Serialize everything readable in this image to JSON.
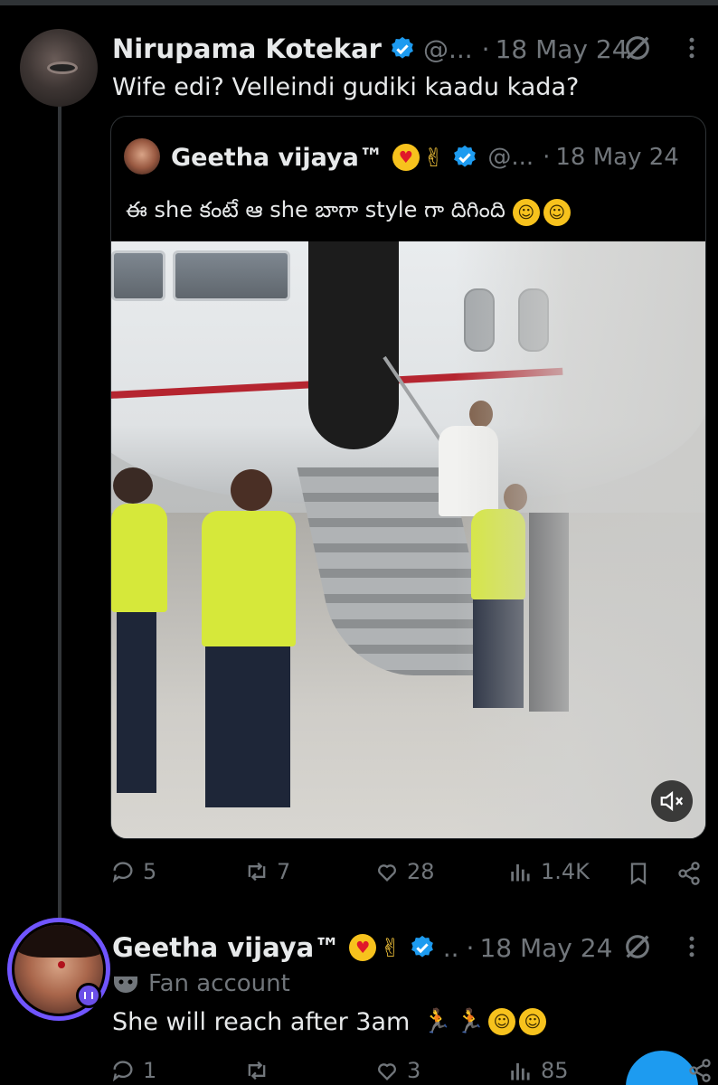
{
  "tweet1": {
    "name": "Nirupama Kotekar",
    "handle": "@...",
    "sep": "·",
    "date": "18 May 24",
    "text": "Wife edi? Velleindi gudiki kaadu kada?",
    "stats": {
      "replies": "5",
      "reposts": "7",
      "likes": "28",
      "views": "1.4K"
    }
  },
  "quote": {
    "name": "Geetha vijaya™",
    "handle": "@...",
    "sep": "·",
    "date": "18 May 24",
    "text": "ఈ she కంటే ఆ she బాగా style గా దిగింది"
  },
  "tweet2": {
    "name": "Geetha vijaya™",
    "handle": "..",
    "sep": "·",
    "date": "18 May 24",
    "label": "Fan account",
    "text": "She will reach after 3am",
    "stats": {
      "replies": "1",
      "reposts": "",
      "likes": "3",
      "views": "85"
    }
  },
  "icons": [
    "grok-icon",
    "more-icon",
    "verified-icon",
    "reply-icon",
    "repost-icon",
    "like-icon",
    "views-icon",
    "bookmark-icon",
    "share-icon",
    "mute-icon",
    "mask-icon"
  ],
  "colors": {
    "background": "#000000",
    "text": "#e7e9ea",
    "muted": "#71767b",
    "verified": "#1d9bf0",
    "ring": "#7055ff",
    "border": "#2f3336"
  }
}
